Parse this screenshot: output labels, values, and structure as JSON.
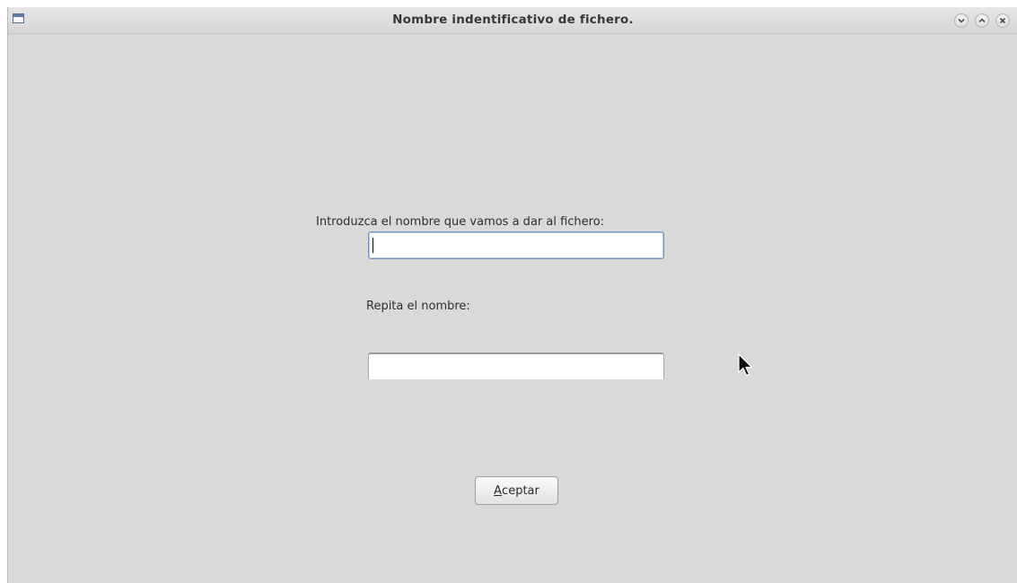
{
  "window": {
    "title": "Nombre indentificativo de fichero."
  },
  "titlebar_buttons": {
    "minimize_icon": "chevron-down-icon",
    "maximize_icon": "chevron-up-icon",
    "close_icon": "close-icon"
  },
  "form": {
    "name_label": "Introduzca el nombre que vamos a dar al fichero:",
    "name_value": "",
    "repeat_label": "Repita el nombre:",
    "repeat_value": ""
  },
  "accept_button": {
    "mnemonic": "A",
    "rest": "ceptar"
  },
  "colors": {
    "window_background": "#d9d9d9",
    "focus_border": "#6f93c3"
  }
}
